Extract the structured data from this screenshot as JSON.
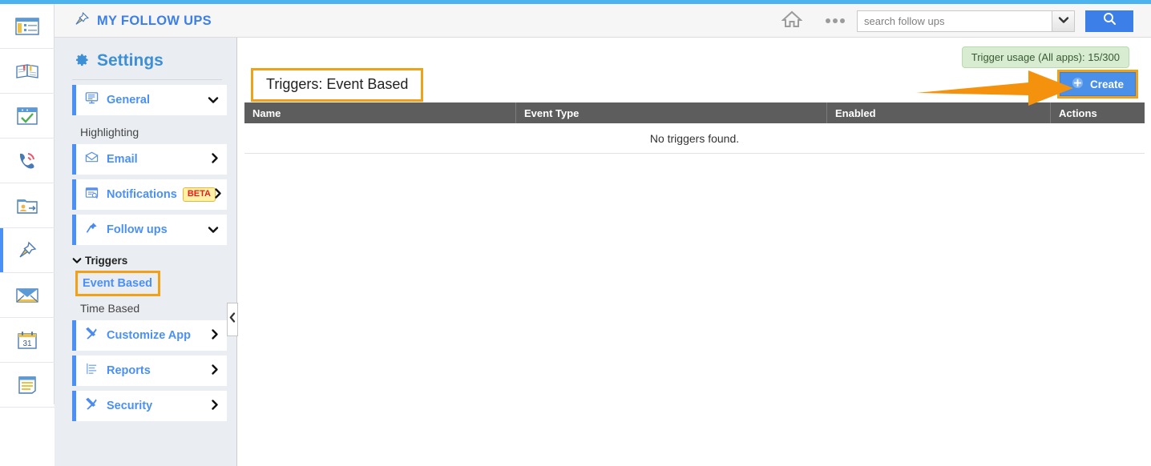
{
  "theme": {
    "accent_blue": "#4a90f7",
    "top_strip": "#4bb3ee",
    "highlight_orange": "#f2a018",
    "table_header": "#5d5d5d",
    "usage_green": "#d7ecd0"
  },
  "rail": {
    "items": [
      {
        "icon": "news-list-icon",
        "active": false
      },
      {
        "icon": "open-book-icon",
        "active": false
      },
      {
        "icon": "task-check-icon",
        "active": false
      },
      {
        "icon": "phone-call-icon",
        "active": false
      },
      {
        "icon": "contact-folder-icon",
        "active": false
      },
      {
        "icon": "pushpin-icon",
        "active": true
      },
      {
        "icon": "envelope-icon",
        "active": false
      },
      {
        "icon": "calendar-31-icon",
        "active": false
      },
      {
        "icon": "notepad-icon",
        "active": false
      }
    ]
  },
  "header": {
    "title": "MY FOLLOW UPS",
    "title_icon": "pushpin-icon",
    "home_icon": "home-icon",
    "more_icon": "ellipsis-icon",
    "search": {
      "placeholder": "search follow ups",
      "value": "",
      "dropdown_icon": "chevron-down-icon",
      "submit_icon": "magnifier-icon"
    }
  },
  "settings": {
    "heading": "Settings",
    "heading_icon": "gear-icon",
    "nav": [
      {
        "label": "General",
        "icon": "monitor-icon",
        "chevron": "down",
        "badge": null
      },
      {
        "label": "Email",
        "icon": "envelope-open-icon",
        "chevron": "right",
        "badge": null
      },
      {
        "label": "Notifications",
        "icon": "notification-icon",
        "chevron": "right",
        "badge": "BETA"
      },
      {
        "label": "Follow ups",
        "icon": "pushpin-icon",
        "chevron": "down",
        "badge": null
      },
      {
        "label": "Customize App",
        "icon": "tools-icon",
        "chevron": "right",
        "badge": null
      },
      {
        "label": "Reports",
        "icon": "report-icon",
        "chevron": "right",
        "badge": null
      },
      {
        "label": "Security",
        "icon": "tools-icon",
        "chevron": "right",
        "badge": null
      }
    ],
    "general_sub": "Highlighting",
    "triggers_group": "Triggers",
    "triggers_sub": [
      {
        "label": "Event Based",
        "selected": true
      },
      {
        "label": "Time Based",
        "selected": false
      }
    ],
    "collapse_icon": "chevron-left-icon"
  },
  "main": {
    "usage_pill": "Trigger usage (All apps): 15/300",
    "page_title": "Triggers: Event Based",
    "create_label": "Create",
    "create_icon": "circle-plus-icon",
    "table": {
      "columns": [
        "Name",
        "Event Type",
        "Enabled",
        "Actions"
      ],
      "rows": [],
      "empty_message": "No triggers found."
    }
  },
  "annotations": {
    "arrow_to_create": "orange-arrow-icon",
    "highlight_boxes": [
      "page-title",
      "create-button",
      "sidebar-event-based"
    ]
  }
}
